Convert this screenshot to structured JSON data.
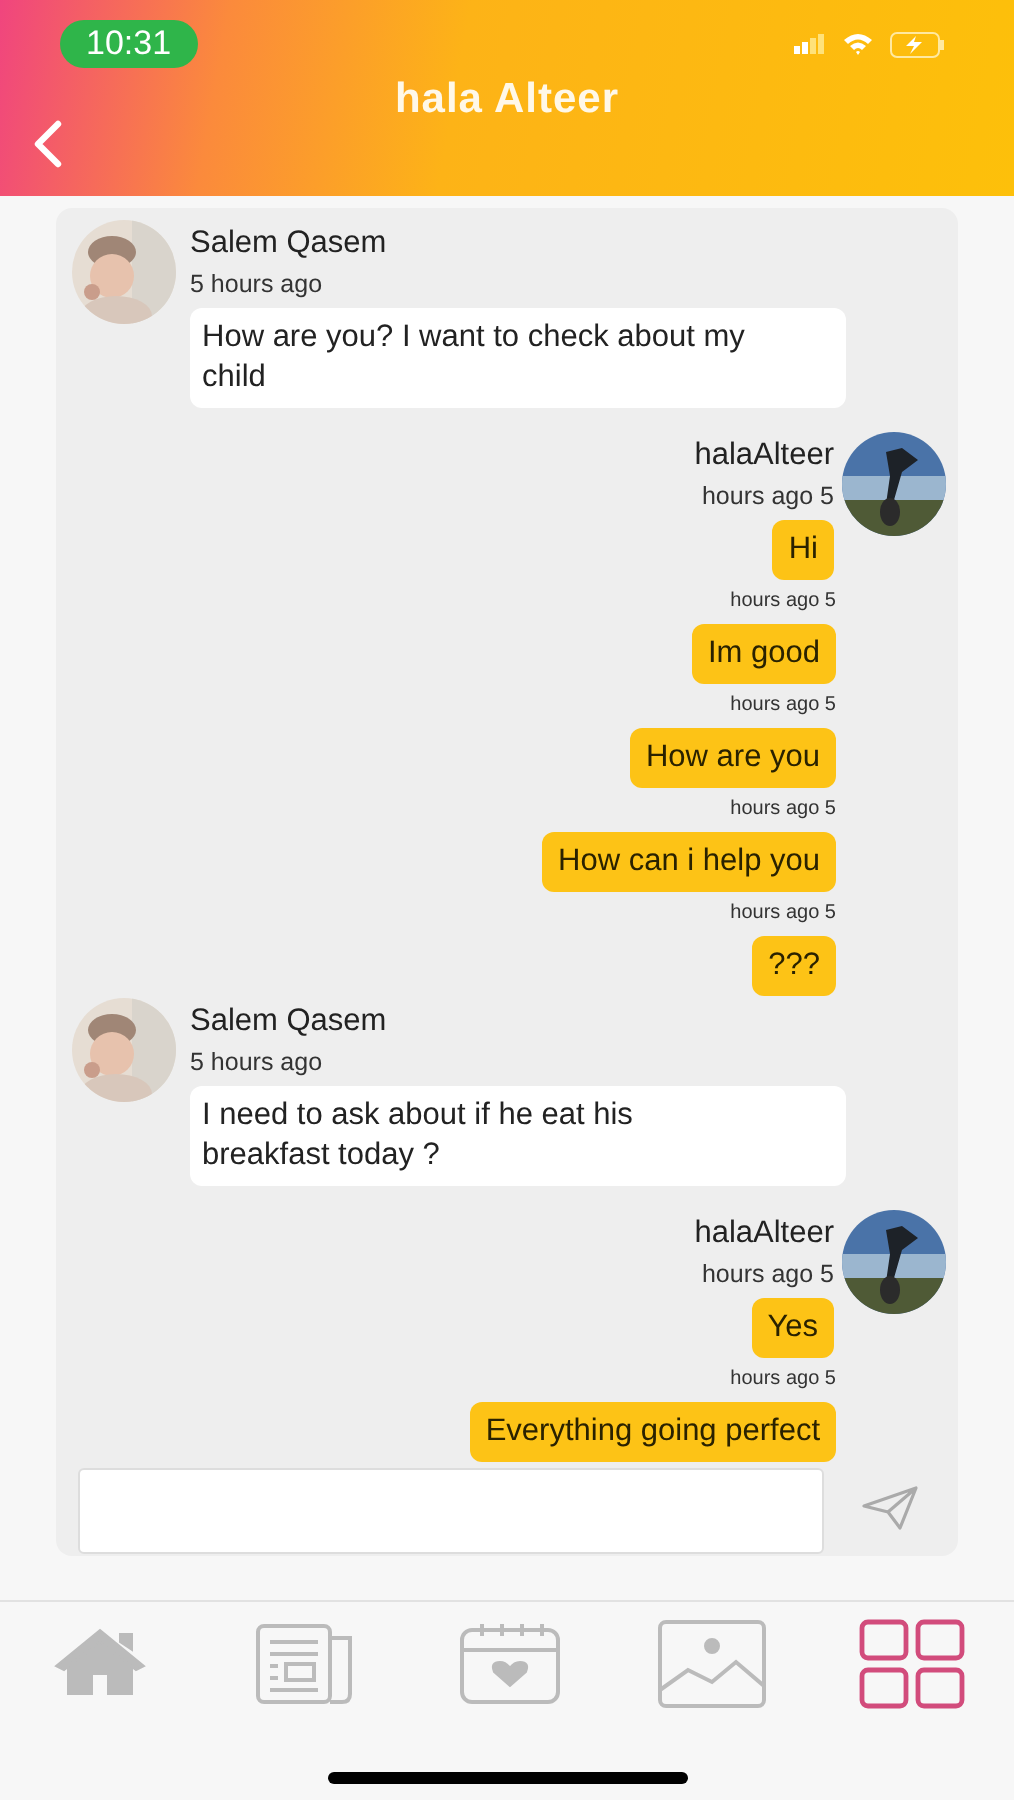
{
  "status_bar": {
    "time": "10:31"
  },
  "header": {
    "title": "hala Alteer"
  },
  "messages": [
    {
      "kind": "incoming",
      "sender": "Salem Qasem",
      "time": "5 hours ago",
      "text": "How are you? I want to check about my child"
    },
    {
      "kind": "outgoing",
      "sender": "halaAlteer",
      "time": "hours ago 5",
      "text": "Hi"
    },
    {
      "kind": "followup",
      "time": "hours ago 5",
      "text": "Im good"
    },
    {
      "kind": "followup",
      "time": "hours ago 5",
      "text": "How are you"
    },
    {
      "kind": "followup",
      "time": "hours ago 5",
      "text": "How can i help you"
    },
    {
      "kind": "followup",
      "time": "hours ago 5",
      "text": "???"
    },
    {
      "kind": "incoming",
      "sender": "Salem Qasem",
      "time": "5 hours ago",
      "text": "I need to ask about if he eat his breakfast today ?"
    },
    {
      "kind": "outgoing",
      "sender": "halaAlteer",
      "time": "hours ago 5",
      "text": "Yes"
    },
    {
      "kind": "followup",
      "time": "hours ago 5",
      "text": "Everything going perfect"
    }
  ],
  "tab_bar": [
    {
      "kind": "home",
      "selected": false
    },
    {
      "kind": "news",
      "selected": false
    },
    {
      "kind": "calendar",
      "selected": false
    },
    {
      "kind": "gallery",
      "selected": false
    },
    {
      "kind": "grid",
      "selected": true
    }
  ]
}
